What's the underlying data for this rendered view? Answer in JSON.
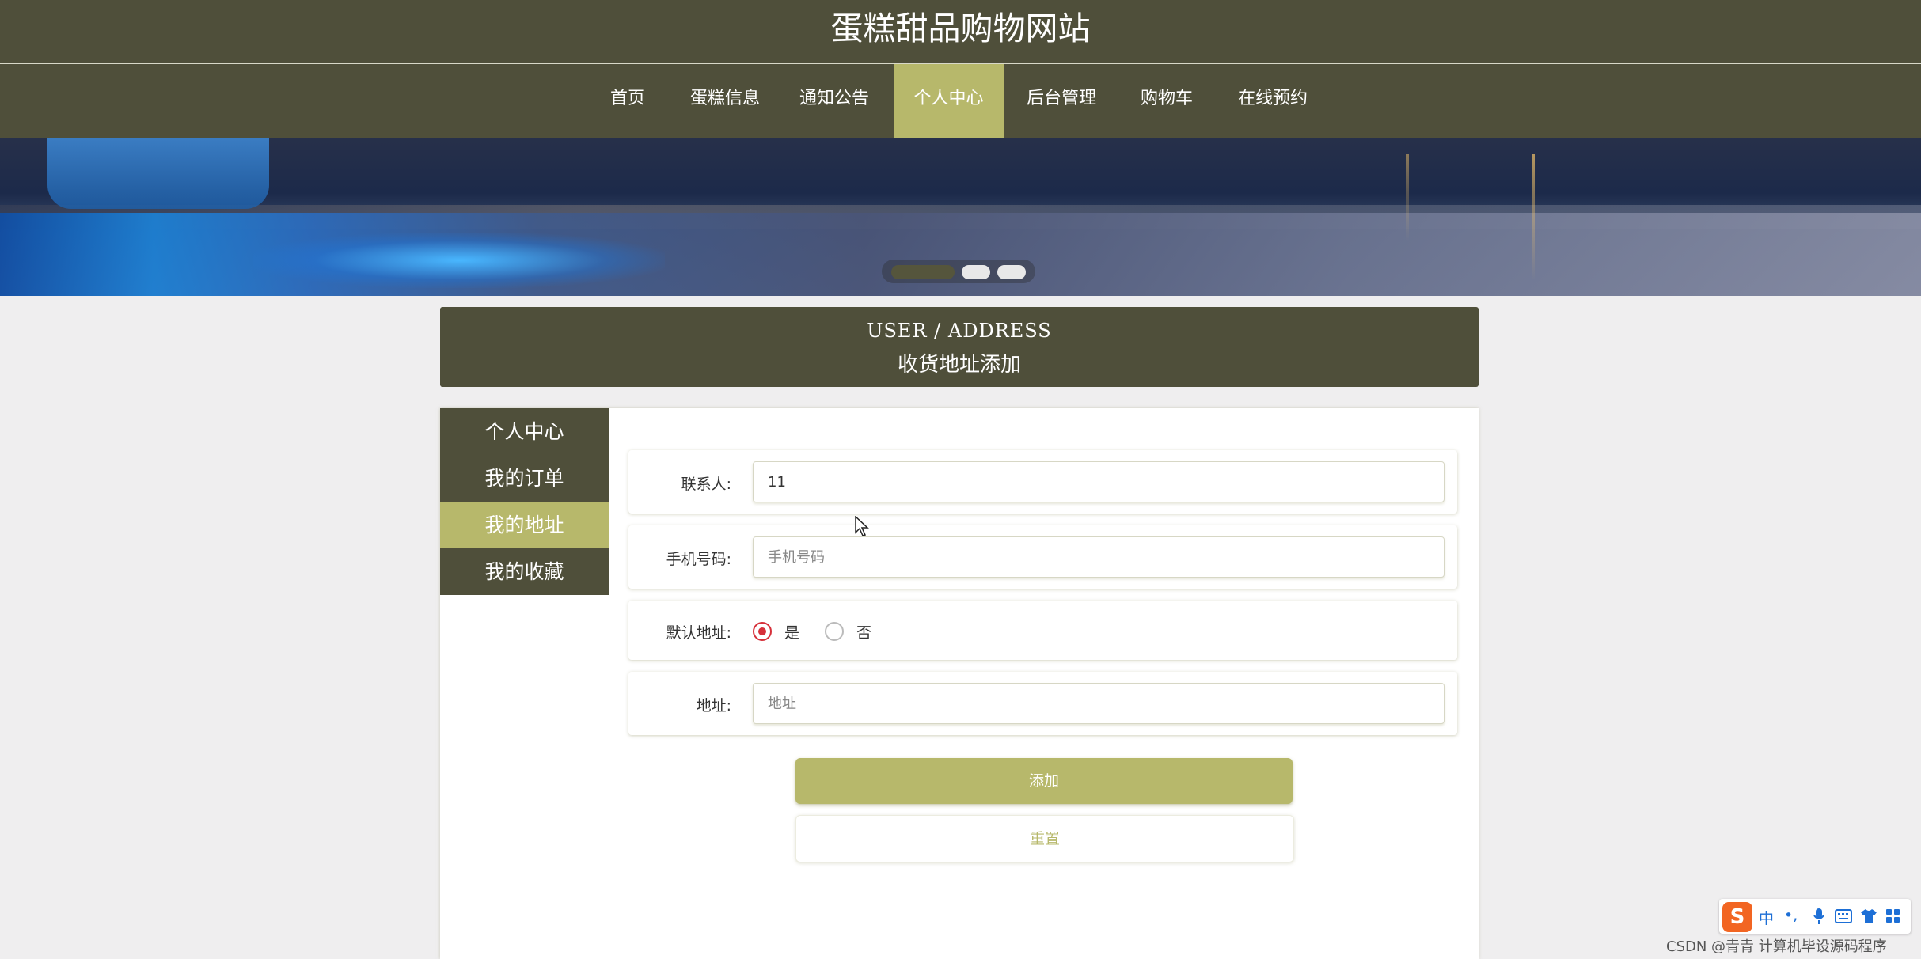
{
  "site": {
    "title": "蛋糕甜品购物网站"
  },
  "nav": {
    "items": [
      {
        "label": "首页",
        "active": false
      },
      {
        "label": "蛋糕信息",
        "active": false
      },
      {
        "label": "通知公告",
        "active": false
      },
      {
        "label": "个人中心",
        "active": true
      },
      {
        "label": "后台管理",
        "active": false
      },
      {
        "label": "购物车",
        "active": false
      },
      {
        "label": "在线预约",
        "active": false
      }
    ]
  },
  "carousel": {
    "slide_count": 3,
    "active_index": 0
  },
  "section": {
    "title_en": "USER / ADDRESS",
    "title_cn": "收货地址添加"
  },
  "sidebar": {
    "items": [
      {
        "label": "个人中心",
        "active": false
      },
      {
        "label": "我的订单",
        "active": false
      },
      {
        "label": "我的地址",
        "active": true
      },
      {
        "label": "我的收藏",
        "active": false
      }
    ]
  },
  "form": {
    "contact": {
      "label": "联系人:",
      "value": "11",
      "placeholder": ""
    },
    "phone": {
      "label": "手机号码:",
      "value": "",
      "placeholder": "手机号码"
    },
    "default_address": {
      "label": "默认地址:",
      "options": [
        {
          "label": "是",
          "checked": true
        },
        {
          "label": "否",
          "checked": false
        }
      ]
    },
    "address": {
      "label": "地址:",
      "value": "",
      "placeholder": "地址"
    },
    "add_label": "添加",
    "reset_label": "重置"
  },
  "ime_toolbar": {
    "logo": "S",
    "mode": "中",
    "punct": "•,"
  },
  "watermark": "CSDN @青青 计算机毕设源码程序",
  "colors": {
    "header_bg": "#4f4f3a",
    "accent": "#b7b86b",
    "page_bg": "#efeeef",
    "radio_checked": "#d6303a"
  }
}
